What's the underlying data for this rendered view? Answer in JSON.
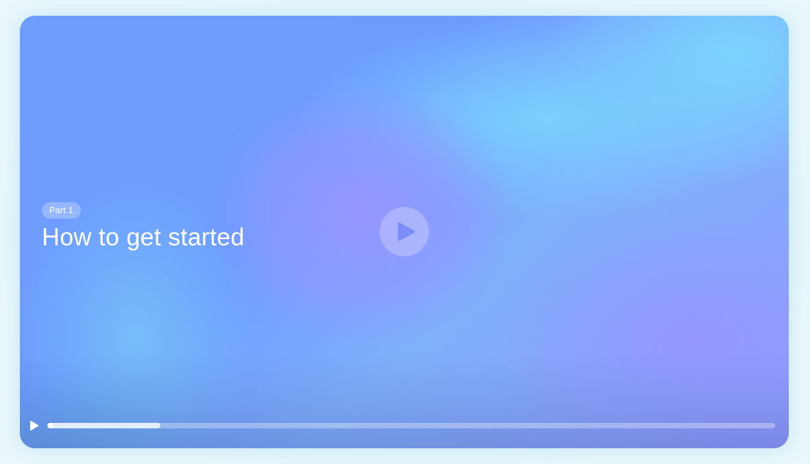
{
  "video": {
    "part_label": "Part 1",
    "title": "How to get started"
  },
  "controls": {
    "big_play_icon": "play-icon",
    "small_play_icon": "play-icon",
    "progress_fraction": 0.155
  },
  "colors": {
    "accent_blue": "#6e9cff",
    "accent_cyan": "#7ad4ff",
    "accent_violet": "#9196ff"
  }
}
